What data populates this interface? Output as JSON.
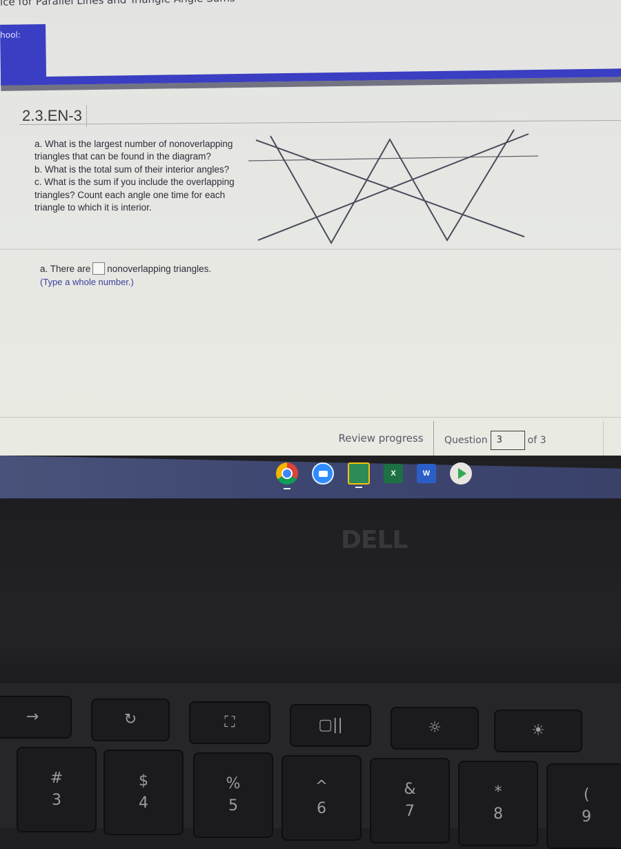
{
  "window": {
    "title": "tice for Parallel Lines and Triangle Angle Sums",
    "school_label": "hool:"
  },
  "question": {
    "id": "2.3.EN-3",
    "prompt": [
      "a. What is the largest number of nonoverlapping triangles that can be found in the diagram?",
      "b. What is the total sum of their interior angles?",
      "c. What is the sum if you include the overlapping triangles? Count each angle one time for each triangle to which it is interior."
    ],
    "answer": {
      "prefix": "a. There are",
      "value": "",
      "suffix": "nonoverlapping triangles.",
      "hint": "(Type a whole number.)"
    }
  },
  "footer": {
    "review_label": "Review progress",
    "question_label": "Question",
    "question_value": "3",
    "of_label": "of 3"
  },
  "shelf": {
    "apps": [
      {
        "name": "chrome-icon",
        "label": ""
      },
      {
        "name": "zoom-icon",
        "label": ""
      },
      {
        "name": "google-classroom-icon",
        "label": ""
      },
      {
        "name": "excel-icon",
        "label": "X"
      },
      {
        "name": "word-icon",
        "label": "W"
      },
      {
        "name": "play-store-icon",
        "label": ""
      }
    ]
  },
  "bezel": {
    "brand": "DELL"
  },
  "keyboard": {
    "function_row": [
      "→",
      "↻",
      "⛶",
      "▢||",
      "☼",
      "☀"
    ],
    "number_row": [
      {
        "top": "#",
        "bottom": "3"
      },
      {
        "top": "$",
        "bottom": "4"
      },
      {
        "top": "%",
        "bottom": "5"
      },
      {
        "top": "^",
        "bottom": "6"
      },
      {
        "top": "&",
        "bottom": "7"
      },
      {
        "top": "*",
        "bottom": "8"
      },
      {
        "top": "(",
        "bottom": "9"
      }
    ]
  },
  "colors": {
    "brand_blue": "#3a3ec2",
    "hint_text": "#3b3fa0",
    "screen_bg": "#e6e7e3",
    "shelf_bg": "#434c74"
  }
}
